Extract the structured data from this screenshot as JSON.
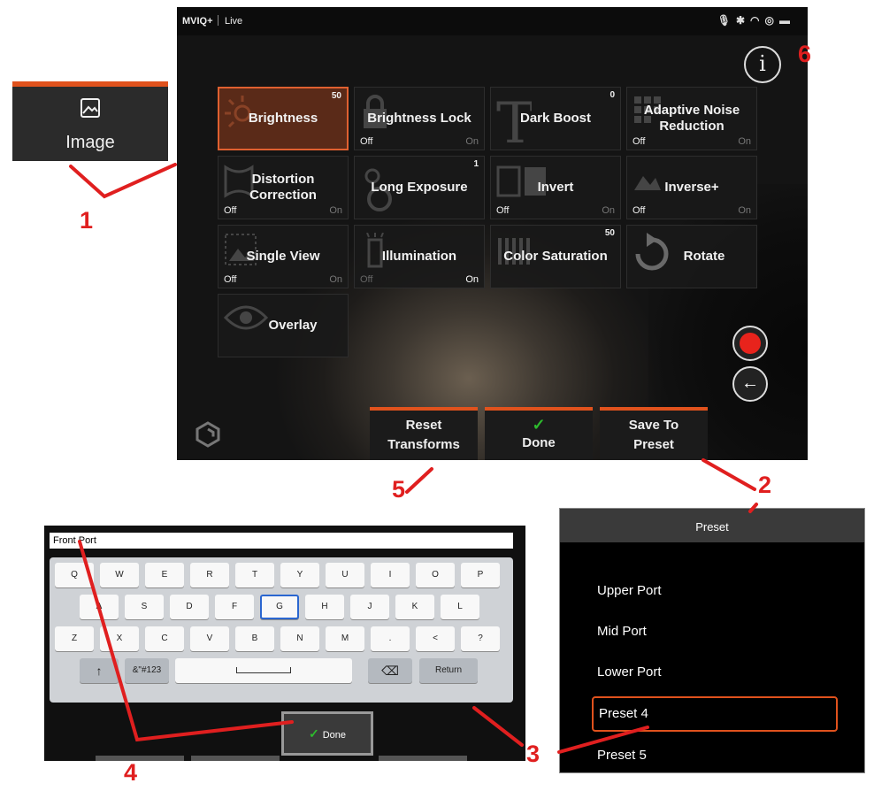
{
  "screen": {
    "status": {
      "brand": "MVIQ+",
      "mode": "Live"
    },
    "info_label": "i",
    "tiles": [
      {
        "label": "Brightness",
        "value": "50",
        "selected": true
      },
      {
        "label": "Brightness Lock",
        "off": "Off",
        "on": "On"
      },
      {
        "label": "Dark Boost",
        "value": "0"
      },
      {
        "label": "Adaptive Noise Reduction",
        "off": "Off",
        "on": "On"
      },
      {
        "label": "Distortion Correction",
        "off": "Off",
        "on": "On"
      },
      {
        "label": "Long Exposure",
        "value": "1"
      },
      {
        "label": "Invert",
        "off": "Off",
        "on": "On"
      },
      {
        "label": "Inverse+",
        "off": "Off",
        "on": "On"
      },
      {
        "label": "Single View",
        "off": "Off",
        "on": "On"
      },
      {
        "label": "Illumination",
        "off": "Off",
        "on": "On"
      },
      {
        "label": "Color Saturation",
        "value": "50"
      },
      {
        "label": "Rotate"
      },
      {
        "label": "Overlay"
      }
    ],
    "bottom_buttons": {
      "reset_line1": "Reset",
      "reset_line2": "Transforms",
      "done": "Done",
      "save_line1": "Save To",
      "save_line2": "Preset"
    }
  },
  "image_button": {
    "label": "Image"
  },
  "keyboard": {
    "field_value": "Front Port",
    "row1": [
      "Q",
      "W",
      "E",
      "R",
      "T",
      "Y",
      "U",
      "I",
      "O",
      "P"
    ],
    "row2": [
      "A",
      "S",
      "D",
      "F",
      "G",
      "H",
      "J",
      "K",
      "L"
    ],
    "row3": [
      "Z",
      "X",
      "C",
      "V",
      "B",
      "N",
      "M",
      ".",
      "<",
      "?"
    ],
    "row4": {
      "shift": "↑",
      "symbols": "&\"#123",
      "space": "",
      "backspace": "⌫",
      "return": "Return"
    },
    "done_label": "Done"
  },
  "preset_panel": {
    "title": "Preset",
    "items": [
      "Upper Port",
      "Mid Port",
      "Lower Port",
      "Preset 4",
      "Preset 5"
    ]
  },
  "callouts": [
    "1",
    "2",
    "3",
    "4",
    "5",
    "6"
  ],
  "colors": {
    "accent": "#e0521d",
    "callout": "#e01f1f",
    "record": "#e8231c",
    "check": "#2dbb2d"
  }
}
